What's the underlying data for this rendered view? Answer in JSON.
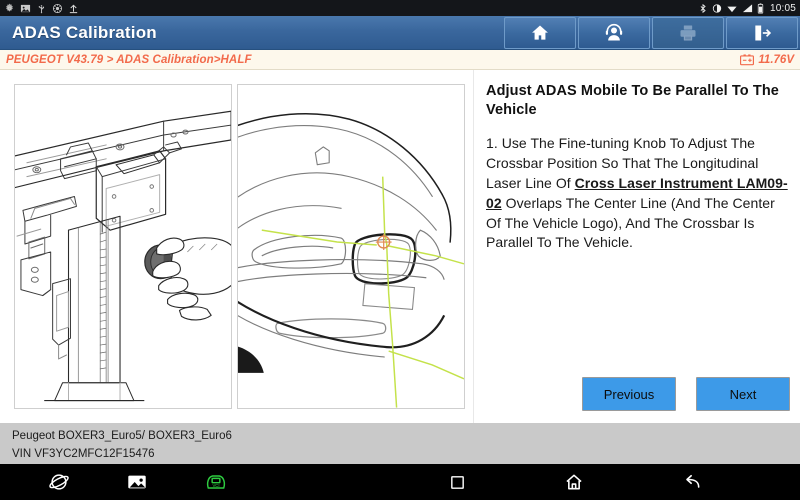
{
  "statusbar": {
    "left_icons": [
      "settings-gear-icon",
      "screenshot-icon",
      "usb-icon",
      "debug-bug-icon",
      "upload-icon"
    ],
    "right_icons": [
      "bluetooth-icon",
      "brightness-icon",
      "wifi-icon",
      "signal-icon",
      "battery-icon"
    ],
    "time": "10:05"
  },
  "header": {
    "title": "ADAS Calibration",
    "buttons": [
      {
        "name": "home-button",
        "icon": "home-icon",
        "disabled": false
      },
      {
        "name": "support-button",
        "icon": "headset-icon",
        "disabled": false
      },
      {
        "name": "print-button",
        "icon": "printer-icon",
        "disabled": true
      },
      {
        "name": "exit-button",
        "icon": "exit-icon",
        "disabled": false
      }
    ]
  },
  "breadcrumb": {
    "text": "PEUGEOT V43.79 > ADAS Calibration>HALF",
    "voltage": "11.76V",
    "voltage_icon": "battery-voltage-icon"
  },
  "main": {
    "left_panel": {
      "name": "calibration-frame-diagram",
      "description": "Hand turning fine-tuning knob on ADAS calibration frame crossbar"
    },
    "right_panel": {
      "name": "vehicle-front-diagram",
      "description": "Front view of vehicle with cross laser lines over center logo",
      "laser_color": "#c4e24a",
      "target_color": "#e08a50"
    },
    "instruction": {
      "title": "Adjust ADAS Mobile To Be Parallel To The Vehicle",
      "body_part1": "1. Use The Fine-tuning Knob To Adjust The Crossbar Position So That The Longitudinal Laser Line Of ",
      "body_highlight": "Cross Laser Instrument LAM09-02",
      "body_part2": " Overlaps The Center Line (And The Center Of The Vehicle Logo), And The Crossbar Is Parallel To The Vehicle."
    },
    "buttons": {
      "previous": "Previous",
      "next": "Next",
      "accent_color": "#3d9ae8"
    }
  },
  "vehicle_info": {
    "model": "Peugeot BOXER3_Euro5/ BOXER3_Euro6",
    "vin": "VIN VF3YC2MFC12F15476"
  },
  "navbar": {
    "left_icons": [
      "browser-icon",
      "gallery-icon",
      "vci-connector-icon"
    ],
    "right_icons": [
      "recents-square-icon",
      "home-icon",
      "back-icon"
    ],
    "vci_color": "#2ecc40"
  }
}
